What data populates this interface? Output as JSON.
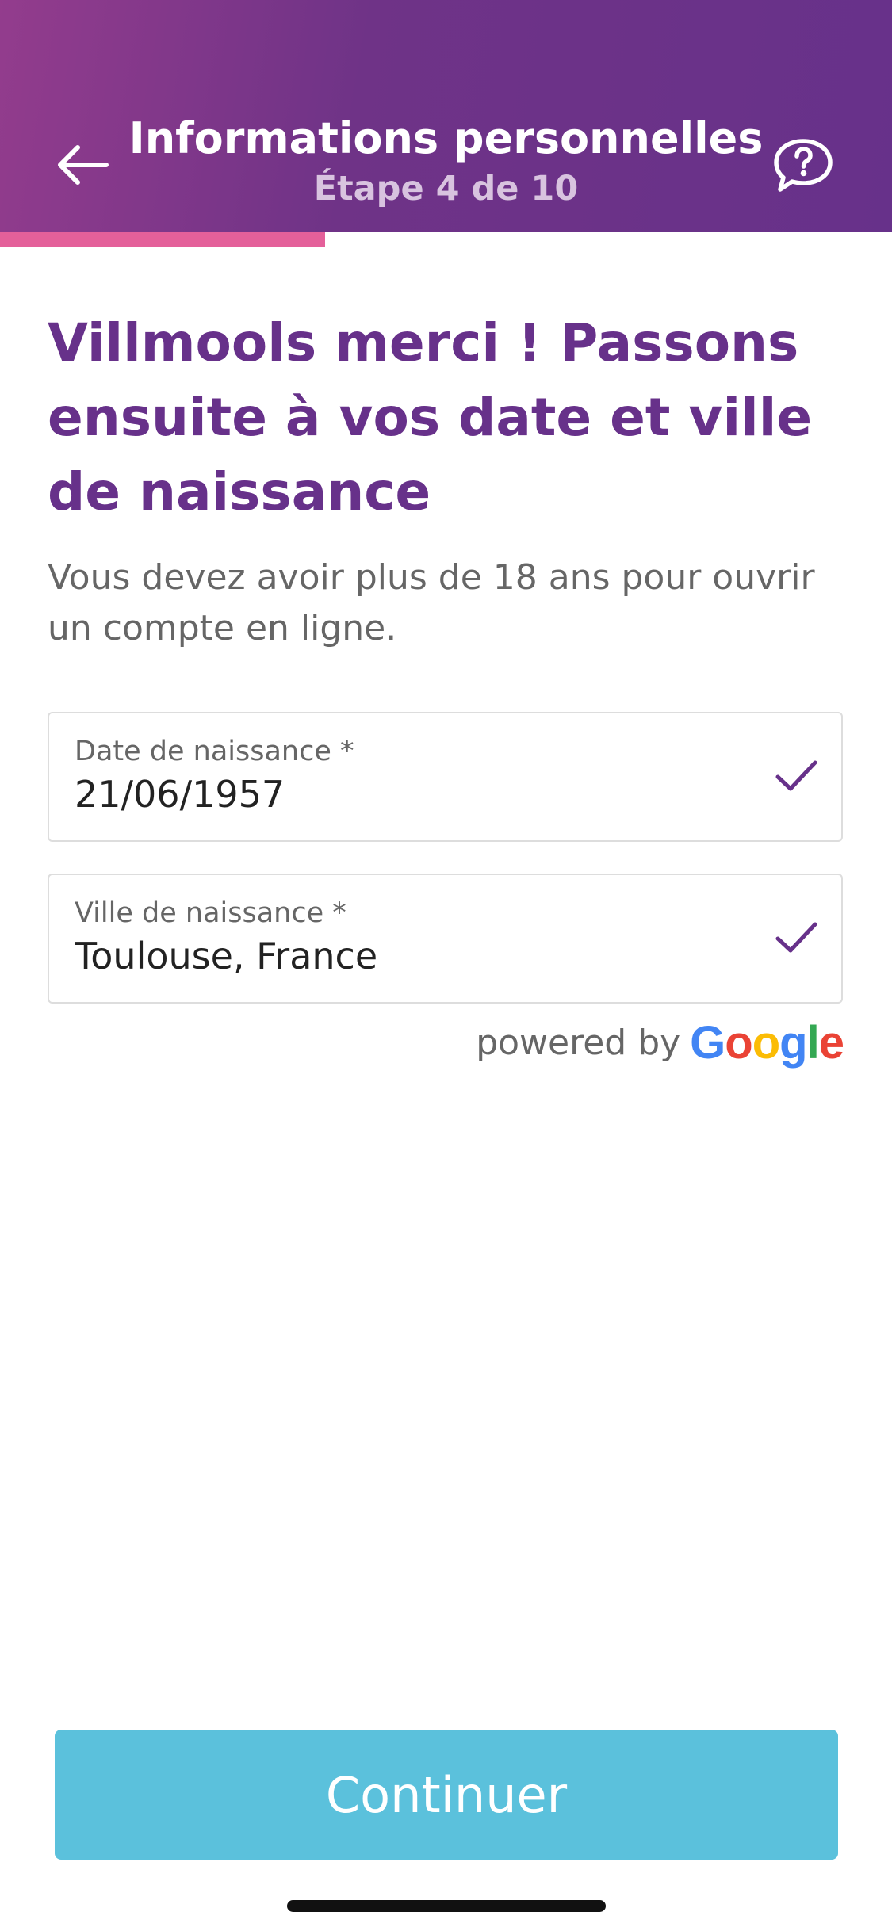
{
  "header": {
    "title": "Informations personnelles",
    "step": "Étape 4 de 10",
    "progress": 0.4,
    "back_icon": "arrow-left-icon",
    "help_icon": "chat-question-icon"
  },
  "content": {
    "headline": "Villmools merci ! Passons ensuite à vos date et ville de naissance",
    "subtext": "Vous devez avoir plus de 18 ans pour ouvrir un compte en ligne."
  },
  "fields": {
    "birth_date": {
      "label": "Date de naissance *",
      "value": "21/06/1957",
      "valid_icon": "check-icon"
    },
    "birth_city": {
      "label": "Ville de naissance *",
      "value": "Toulouse, France",
      "valid_icon": "check-icon"
    }
  },
  "attribution": {
    "prefix": "powered by",
    "google_letters": [
      "G",
      "o",
      "o",
      "g",
      "l",
      "e"
    ]
  },
  "footer": {
    "continue_label": "Continuer"
  },
  "colors": {
    "brand_purple": "#67318a",
    "progress_pink": "#e4609a",
    "button_blue": "#5bc1dc",
    "google_blue": "#4285F4",
    "google_red": "#EA4335",
    "google_yellow": "#FBBC05",
    "google_green": "#34A853"
  }
}
